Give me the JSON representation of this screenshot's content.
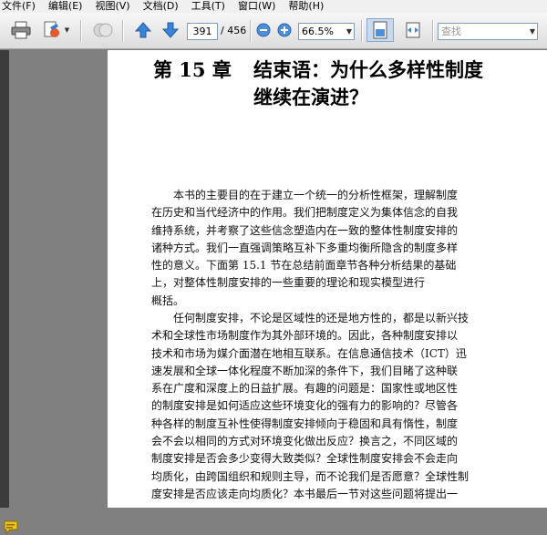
{
  "menu": {
    "items": [
      "文件(F)",
      "编辑(E)",
      "视图(V)",
      "文档(D)",
      "工具(T)",
      "窗口(W)",
      "帮助(H)"
    ]
  },
  "toolbar": {
    "current_page": "391",
    "total_pages": "/ 456",
    "zoom": "66.5%",
    "search_placeholder": "查找"
  },
  "document": {
    "chapter": "第 15 章",
    "title_line1": "结束语：为什么多样性制度",
    "title_line2": "继续在演进？",
    "paragraph1": [
      "本书的主要目的在于建立一个统一的分析性框架，理解制度",
      "在历史和当代经济中的作用。我们把制度定义为集体信念的自我",
      "维持系统，并考察了这些信念塑造内在一致的整体性制度安排的",
      "诸种方式。我们一直强调策略互补下多重均衡所隐含的制度多样",
      "性的意义。下面第 15.1 节在总结前面章节各种分析结果的基础",
      "上，对整体性制度安排的一些重要的理论和现实模型进行",
      "概括。"
    ],
    "paragraph2": [
      "任何制度安排，不论是区域性的还是地方性的，都是以新兴技",
      "术和全球性市场制度作为其外部环境的。因此，各种制度安排以",
      "技术和市场为媒介面潜在地相互联系。在信息通信技术（ICT）迅",
      "速发展和全球一体化程度不断加深的条件下，我们目睹了这种联",
      "系在广度和深度上的日益扩展。有趣的问题是：国家性或地区性",
      "的制度安排是如何适应这些环境变化的强有力的影响的？尽管各",
      "种各样的制度互补性使得制度安排倾向于稳固和具有惰性，制度",
      "会不会以相同的方式对环境变化做出反应？换言之，不同区域的",
      "制度安排是否会多少变得大致类似？全球性制度安排会不会走向",
      "均质化，由跨国组织和规则主导，而不论我们是否愿意？全球性制",
      "度安排是否应该走向均质化？本书最后一节对这些问题将提出一"
    ]
  }
}
